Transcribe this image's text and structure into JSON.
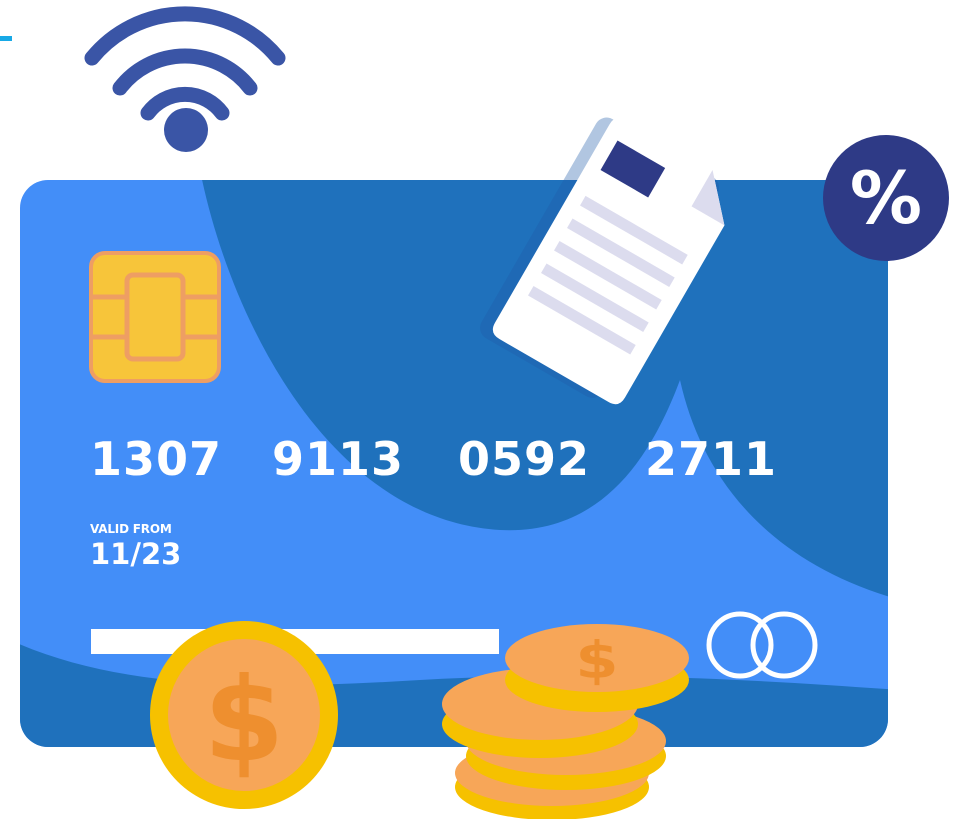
{
  "card": {
    "number_groups": [
      "1307",
      "9113",
      "0592",
      "2711"
    ],
    "valid_label": "VALID FROM",
    "valid_date": "11/23"
  },
  "badge": {
    "symbol": "%"
  },
  "icons": [
    "wifi-icon",
    "percent-badge-icon",
    "document-icon",
    "chip-icon",
    "card-logo-icon",
    "coin-icon",
    "dollar-icon"
  ],
  "colors": {
    "card": "#438ef8",
    "card_dark": "#1f71bc",
    "navy": "#2e3a86",
    "coin": "#f7a658",
    "coin_rim": "#f6c100",
    "chip": "#f7c53a",
    "paper": "#ffffff",
    "paper_lines": "#dcdcee",
    "accent_line": "#17a9e6"
  }
}
